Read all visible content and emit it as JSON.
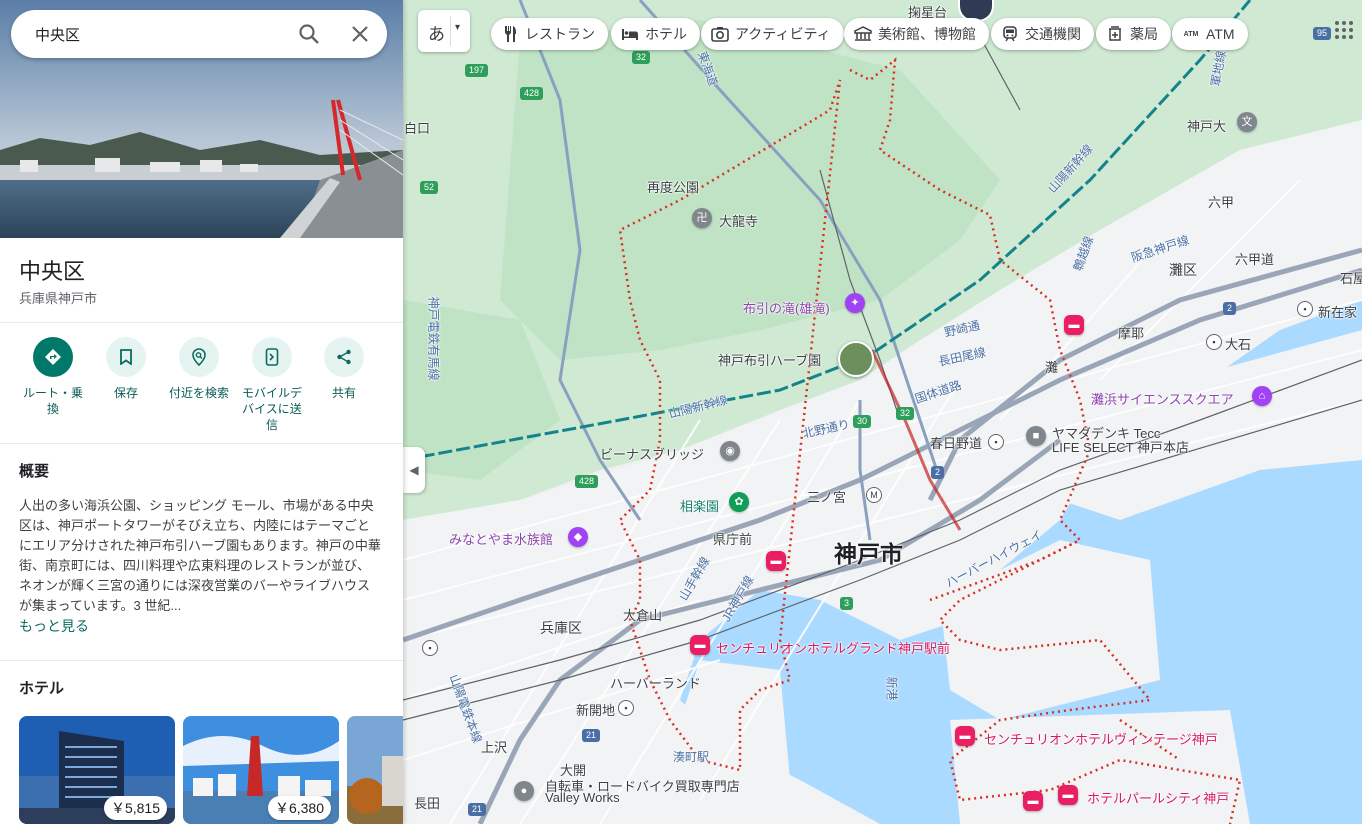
{
  "search": {
    "query": "中央区"
  },
  "place": {
    "title": "中央区",
    "subtitle": "兵庫県神戸市"
  },
  "actions": [
    {
      "label": "ルート・乗換",
      "icon": "directions-icon"
    },
    {
      "label": "保存",
      "icon": "bookmark-icon"
    },
    {
      "label": "付近を検索",
      "icon": "nearby-search-icon"
    },
    {
      "label": "モバイルデバイスに送信",
      "icon": "send-to-phone-icon"
    },
    {
      "label": "共有",
      "icon": "share-icon"
    }
  ],
  "overview": {
    "heading": "概要",
    "text": "人出の多い海浜公園、ショッピング モール、市場がある中央区は、神戸ポートタワーがそびえ立ち、内陸にはテーマごとにエリア分けされた神戸布引ハーブ園もあります。神戸の中華街、南京町には、四川料理や広東料理のレストランが並び、ネオンが輝く三宮の通りには深夜営業のバーやライブハウスが集まっています。3 世紀...",
    "more": "もっと見る"
  },
  "hotels": {
    "heading": "ホテル",
    "items": [
      {
        "price": "￥5,815"
      },
      {
        "price": "￥6,380"
      },
      {
        "price": ""
      }
    ]
  },
  "language_button": {
    "label": "あ"
  },
  "chips": [
    {
      "label": "レストラン",
      "icon": "restaurant-icon"
    },
    {
      "label": "ホテル",
      "icon": "hotel-icon"
    },
    {
      "label": "アクティビティ",
      "icon": "camera-icon"
    },
    {
      "label": "美術館、博物館",
      "icon": "museum-icon"
    },
    {
      "label": "交通機関",
      "icon": "transit-icon"
    },
    {
      "label": "薬局",
      "icon": "pharmacy-icon"
    },
    {
      "label": "ATM",
      "icon": "atm-icon"
    }
  ],
  "map_labels": {
    "city": "神戸市",
    "hyogo_ward": "兵庫区",
    "nada_ward": "灘区",
    "kikuseidai": "掬星台",
    "kobe_dai": "神戸大",
    "rokko": "六甲",
    "rokkomichi": "六甲道",
    "ishiya": "石屋",
    "shinzaike": "新在家",
    "maya": "摩耶",
    "oishi": "大石",
    "nada": "灘",
    "futatabi_park": "再度公園",
    "dairyuji": "大龍寺",
    "nunobiki_falls": "布引の滝(雄滝)",
    "herb_garden": "神戸布引ハーブ園",
    "venus_bridge": "ビーナスブリッジ",
    "sorakuen": "相楽園",
    "minatoyama": "みなとやま水族館",
    "kenchomae": "県庁前",
    "sannomiya": "三ノ宮",
    "kasuganomichi": "春日野道",
    "okurayama": "大倉山",
    "harborland": "ハーバーランド",
    "shinkaichi": "新開地",
    "kamisawa": "上沢",
    "daikai": "大開",
    "nagata": "長田",
    "minatogawa": "湊町駅",
    "century_kobe": "センチュリオンホテルグランド神戸駅前",
    "century_vintage": "センチュリオンホテルヴィンテージ神戸",
    "hotel_pearl": "ホテルパールシティ神戸",
    "yamada_1": "ヤマダデンキ Tecc",
    "yamada_2": "LIFE SELECT 神戸本店",
    "hat_kobe": "灘浜サイエンススクエア",
    "bicycle_1": "自転車・ロードバイク買取専門店",
    "bicycle_2": "Valley Works",
    "sanyo_shinkansen": "山陽新幹線",
    "sanyo_shinkansen_2": "山陽新幹線",
    "harbor_hwy": "ハーバーハイウェイ",
    "kitanodori": "北野通り",
    "kokutai": "国体道路",
    "nagatao": "長田尾線",
    "nozakidori": "野崎通",
    "hanshin": "阪急神戸線",
    "jr_kobe": "JR神戸線",
    "yamate": "山手幹線",
    "tokaido": "東海道",
    "kobe_dentetsu": "神戸電鉄有馬線",
    "karasuhara": "鵯越線",
    "gunkei": "軍地線",
    "hakko": "白口",
    "sando": "山陽電鉄本線",
    "shinko": "新港",
    "highway_197": "197",
    "highway_428": "428",
    "highway_428b": "428",
    "highway_52": "52",
    "highway_32": "32",
    "highway_32b": "32",
    "highway_30": "30",
    "highway_2": "2",
    "highway_2b": "2",
    "highway_3": "3",
    "highway_21": "21",
    "highway_21b": "21",
    "highway_95": "95"
  }
}
